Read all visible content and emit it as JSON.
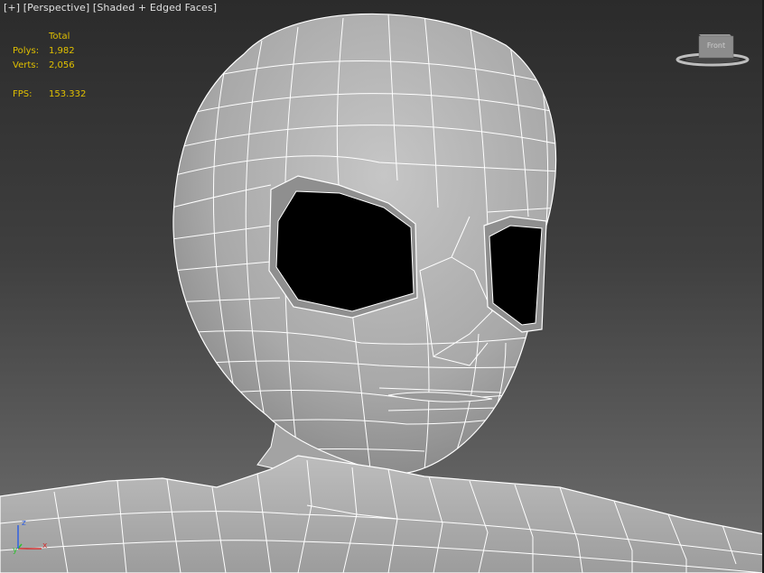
{
  "viewport": {
    "labels": [
      "[+]",
      "[Perspective]",
      "[Shaded + Edged Faces]"
    ]
  },
  "stats": {
    "total_label": "Total",
    "polys_label": "Polys:",
    "polys_value": "1,982",
    "verts_label": "Verts:",
    "verts_value": "2,056",
    "fps_label": "FPS:",
    "fps_value": "153.332"
  },
  "viewcube": {
    "face_text": "Front"
  },
  "axis": {
    "x": "x",
    "y": "y",
    "z": "z"
  },
  "colors": {
    "stats": "#e0c000",
    "mesh_fill": "#b4b4b4",
    "mesh_edge": "#ffffff",
    "axis_x": "#d03030",
    "axis_y": "#30c030",
    "axis_z": "#3060e0"
  }
}
